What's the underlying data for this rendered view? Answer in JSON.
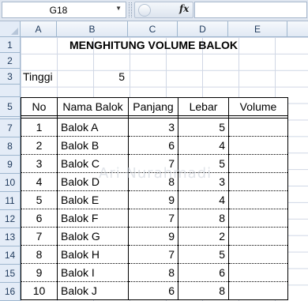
{
  "formula_bar": {
    "name_box": "G18",
    "fx_label": "fx",
    "formula": ""
  },
  "columns": [
    "A",
    "B",
    "C",
    "D",
    "E"
  ],
  "rows": [
    "1",
    "2",
    "3",
    "5",
    "7",
    "8",
    "9",
    "10",
    "11",
    "12",
    "13",
    "14",
    "15",
    "16"
  ],
  "sheet": {
    "title": "MENGHITUNG VOLUME BALOK",
    "tinggi_label": "Tinggi",
    "tinggi_value": "5"
  },
  "table": {
    "headers": [
      "No",
      "Nama Balok",
      "Panjang",
      "Lebar",
      "Volume"
    ],
    "rows": [
      {
        "no": "1",
        "nama": "Balok A",
        "panjang": "3",
        "lebar": "5",
        "volume": ""
      },
      {
        "no": "2",
        "nama": "Balok B",
        "panjang": "6",
        "lebar": "4",
        "volume": ""
      },
      {
        "no": "3",
        "nama": "Balok C",
        "panjang": "7",
        "lebar": "5",
        "volume": ""
      },
      {
        "no": "4",
        "nama": "Balok D",
        "panjang": "8",
        "lebar": "3",
        "volume": ""
      },
      {
        "no": "5",
        "nama": "Balok E",
        "panjang": "9",
        "lebar": "4",
        "volume": ""
      },
      {
        "no": "6",
        "nama": "Balok F",
        "panjang": "7",
        "lebar": "8",
        "volume": ""
      },
      {
        "no": "7",
        "nama": "Balok G",
        "panjang": "9",
        "lebar": "2",
        "volume": ""
      },
      {
        "no": "8",
        "nama": "Balok H",
        "panjang": "7",
        "lebar": "5",
        "volume": ""
      },
      {
        "no": "9",
        "nama": "Balok I",
        "panjang": "8",
        "lebar": "6",
        "volume": ""
      },
      {
        "no": "10",
        "nama": "Balok J",
        "panjang": "6",
        "lebar": "8",
        "volume": ""
      }
    ]
  },
  "watermark": "Ari Nurahmadi",
  "colors": {
    "header_bg": "#e4ecf7",
    "header_text": "#1e395b",
    "gridline": "#d0d7e5"
  }
}
